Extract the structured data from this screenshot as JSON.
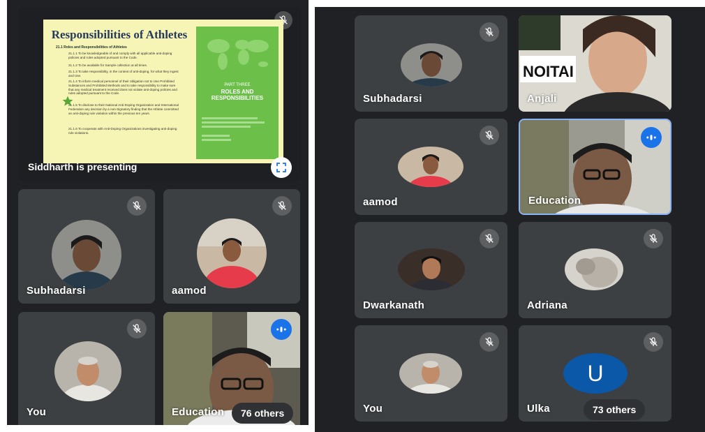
{
  "left": {
    "presentation": {
      "slide_title": "Responsibilities of Athletes",
      "subtitle": "21.1  Roles and Responsibilities of Athletes",
      "rules": [
        {
          "num": "21.1.1",
          "text": "To be knowledgeable of and comply with all applicable anti-doping policies and rules adopted pursuant to the Code."
        },
        {
          "num": "21.1.2",
          "text": "To be available for Sample collection at all times."
        },
        {
          "num": "21.1.3",
          "text": "To take responsibility, in the context of anti-doping, for what they ingest and Use."
        },
        {
          "num": "21.1.4",
          "text": "To inform medical personnel of their obligation not to Use Prohibited Substances and Prohibited Methods and to take responsibility to make sure that any medical treatment received does not violate anti-doping policies and rules adopted pursuant to the Code."
        },
        {
          "num": "21.1.5",
          "text": "To disclose to their National Anti-Doping Organization and International Federation any decision by a non-Signatory finding that the Athlete committed an anti-doping rule violation within the previous ten years."
        },
        {
          "num": "21.1.6",
          "text": "To cooperate with Anti-Doping Organizations investigating anti-doping rule violations."
        }
      ],
      "part_label": "PART THREE",
      "part_heading_1": "ROLES AND",
      "part_heading_2": "RESPONSIBILITIES",
      "presenter_text": "Siddharth is presenting"
    },
    "tiles": [
      {
        "name": "Subhadarsi"
      },
      {
        "name": "aamod"
      },
      {
        "name": "You"
      },
      {
        "name": "Education"
      }
    ],
    "others_label": "76 others"
  },
  "right": {
    "tiles": [
      {
        "name": "Subhadarsi"
      },
      {
        "name": "Anjali"
      },
      {
        "name": "aamod"
      },
      {
        "name": "Education"
      },
      {
        "name": "Dwarkanath"
      },
      {
        "name": "Adriana"
      },
      {
        "name": "You"
      },
      {
        "name": "Ulka",
        "initial": "U"
      }
    ],
    "others_label": "73 others"
  },
  "colors": {
    "background": "#202124",
    "tile": "#3c4043",
    "speaking_accent": "#1a73e8",
    "avatar_u": "#0b57a8",
    "slide_green": "#6cc04a"
  }
}
